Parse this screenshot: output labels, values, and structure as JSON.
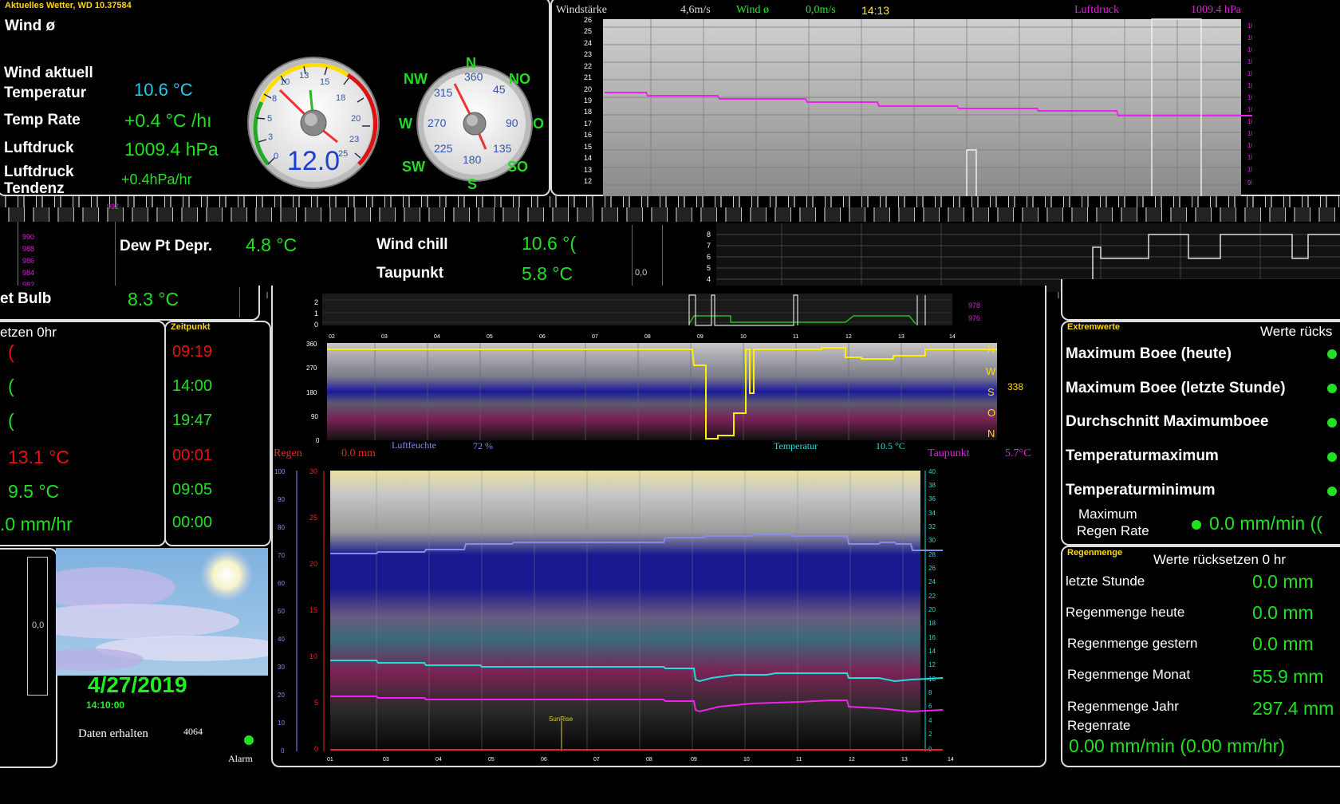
{
  "current": {
    "title": "Aktuelles Wetter, WD 10.37584",
    "wind_avg_label": "Wind ø",
    "wind_now_label": "Wind aktuell",
    "temp_label": "Temperatur",
    "temp_value": "10.6 °C",
    "temp_rate_label": "Temp Rate",
    "temp_rate_value": "+0.4 °C /hı",
    "pressure_label": "Luftdruck",
    "pressure_value": "1009.4 hPa",
    "trend_label1": "Luftdruck",
    "trend_label2": "Tendenz",
    "trend_value": "+0.4hPa/hr"
  },
  "gauge": {
    "speed_value": "12.0",
    "ticks": [
      "0",
      "3",
      "5",
      "8",
      "10",
      "13",
      "15",
      "18",
      "20",
      "23",
      "25"
    ],
    "compass": {
      "N": "N",
      "NO": "NO",
      "O": "O",
      "SO": "SO",
      "S": "S",
      "SW": "SW",
      "W": "W",
      "NW": "NW"
    },
    "compass_degrees": [
      "360",
      "45",
      "90",
      "135",
      "180",
      "225",
      "270",
      "315"
    ]
  },
  "wind_graph": {
    "windstaerke_label": "Windstärke",
    "windstaerke_value": "4,6m/s",
    "wind_avg_label": "Wind ø",
    "wind_avg_value": "0,0m/s",
    "time": "14:13",
    "pressure_label": "Luftdruck",
    "pressure_value": "1009.4 hPa",
    "y_ticks": [
      "26",
      "25",
      "24",
      "23",
      "22",
      "21",
      "20",
      "19",
      "18",
      "17",
      "16",
      "15",
      "14",
      "13",
      "12"
    ],
    "right_ticks": [
      "1024",
      "1022",
      "1020",
      "1018",
      "1016",
      "1014",
      "1012",
      "1010",
      "1008",
      "1006",
      "1004",
      "1002",
      "1000",
      "998"
    ]
  },
  "band": {
    "dew_dep_label": "Dew Pt Depr.",
    "dew_dep_value": "4.8 °C",
    "windchill_label": "Wind chill",
    "windchill_value": "10.6 °(",
    "taupunkt_label": "Taupunkt",
    "taupunkt_value": "5.8 °C",
    "small_zero": "0,0",
    "left_ticks": [
      "990",
      "988",
      "986",
      "984",
      "982"
    ],
    "mini_ticks": [
      "8",
      "7",
      "6",
      "5",
      "4",
      "3"
    ],
    "stray_tick": "992"
  },
  "wet_bulb": {
    "label": "et Bulb",
    "value": "8.3 °C"
  },
  "reset_panel": {
    "title": "etzen 0hr",
    "values": [
      "(",
      "(",
      "(",
      "13.1 °C",
      "9.5 °C",
      ".0 mm/hr"
    ]
  },
  "zeitpunkt": {
    "title": "Zeitpunkt",
    "times": [
      "09:19",
      "14:00",
      "19:47",
      "00:01",
      "09:05",
      "00:00"
    ]
  },
  "dir_graph": {
    "y_ticks": [
      "360",
      "270",
      "180",
      "90",
      "0"
    ],
    "dirs": [
      "N",
      "W",
      "S",
      "O",
      "N"
    ],
    "current_dir": "338",
    "hours": [
      "02",
      "03",
      "04",
      "05",
      "06",
      "07",
      "08",
      "09",
      "10",
      "11",
      "12",
      "13",
      "14"
    ],
    "top_ticks": [
      "2",
      "1",
      "0"
    ],
    "top_right_ticks": [
      "978",
      "976"
    ]
  },
  "main_graph": {
    "regen_label": "Regen",
    "regen_value": "0.0 mm",
    "feuchte_label": "Luftfeuchte",
    "feuchte_value": "72 %",
    "temp_label": "Temperatur",
    "temp_value": "10.5 °C",
    "taupunkt_label": "Taupunkt",
    "taupunkt_value": "5.7°C",
    "left_pct_ticks": [
      "100",
      "90",
      "80",
      "70",
      "60",
      "50",
      "40",
      "30",
      "20",
      "10",
      "0"
    ],
    "left_mm_ticks": [
      "30",
      "25",
      "20",
      "15",
      "10",
      "5",
      "0"
    ],
    "right_ticks": [
      "40",
      "38",
      "36",
      "34",
      "32",
      "30",
      "28",
      "26",
      "24",
      "22",
      "20",
      "18",
      "16",
      "14",
      "12",
      "10",
      "8",
      "6",
      "4",
      "2",
      "0"
    ],
    "hours": [
      "01",
      "03",
      "04",
      "05",
      "06",
      "07",
      "08",
      "09",
      "10",
      "11",
      "12",
      "13",
      "14"
    ],
    "sunrise": "SunRise"
  },
  "bottom_left": {
    "zero": "0,0",
    "date": "4/27/2019",
    "time": "14:10:00",
    "received_label": "Daten erhalten",
    "received_value": "4064",
    "alarm": "Alarm"
  },
  "extreme": {
    "title": "Extremwerte",
    "reset": "Werte rücks",
    "items": [
      "Maximum Boee (heute)",
      "Maximum Boee (letzte Stunde)",
      "Durchschnitt Maximumboee",
      "Temperaturmaximum",
      "Temperaturminimum"
    ],
    "rain_rate_label1": "Maximum",
    "rain_rate_label2": "Regen Rate",
    "rain_rate_value": "0.0 mm/min (("
  },
  "rain": {
    "title": "Regenmenge",
    "reset": "Werte rücksetzen 0 hr",
    "rows": [
      {
        "label": "letzte Stunde",
        "value": "0.0 mm"
      },
      {
        "label": "Regenmenge heute",
        "value": "0.0 mm"
      },
      {
        "label": "Regenmenge gestern",
        "value": "0.0 mm"
      },
      {
        "label": "Regenmenge Monat",
        "value": "55.9 mm"
      },
      {
        "label": "Regenmenge Jahr",
        "value": "297.4 mm"
      }
    ],
    "rate_label": "Regenrate",
    "rate_value": "0.00 mm/min (0.00 mm/hr)"
  },
  "stray_w": "W"
}
